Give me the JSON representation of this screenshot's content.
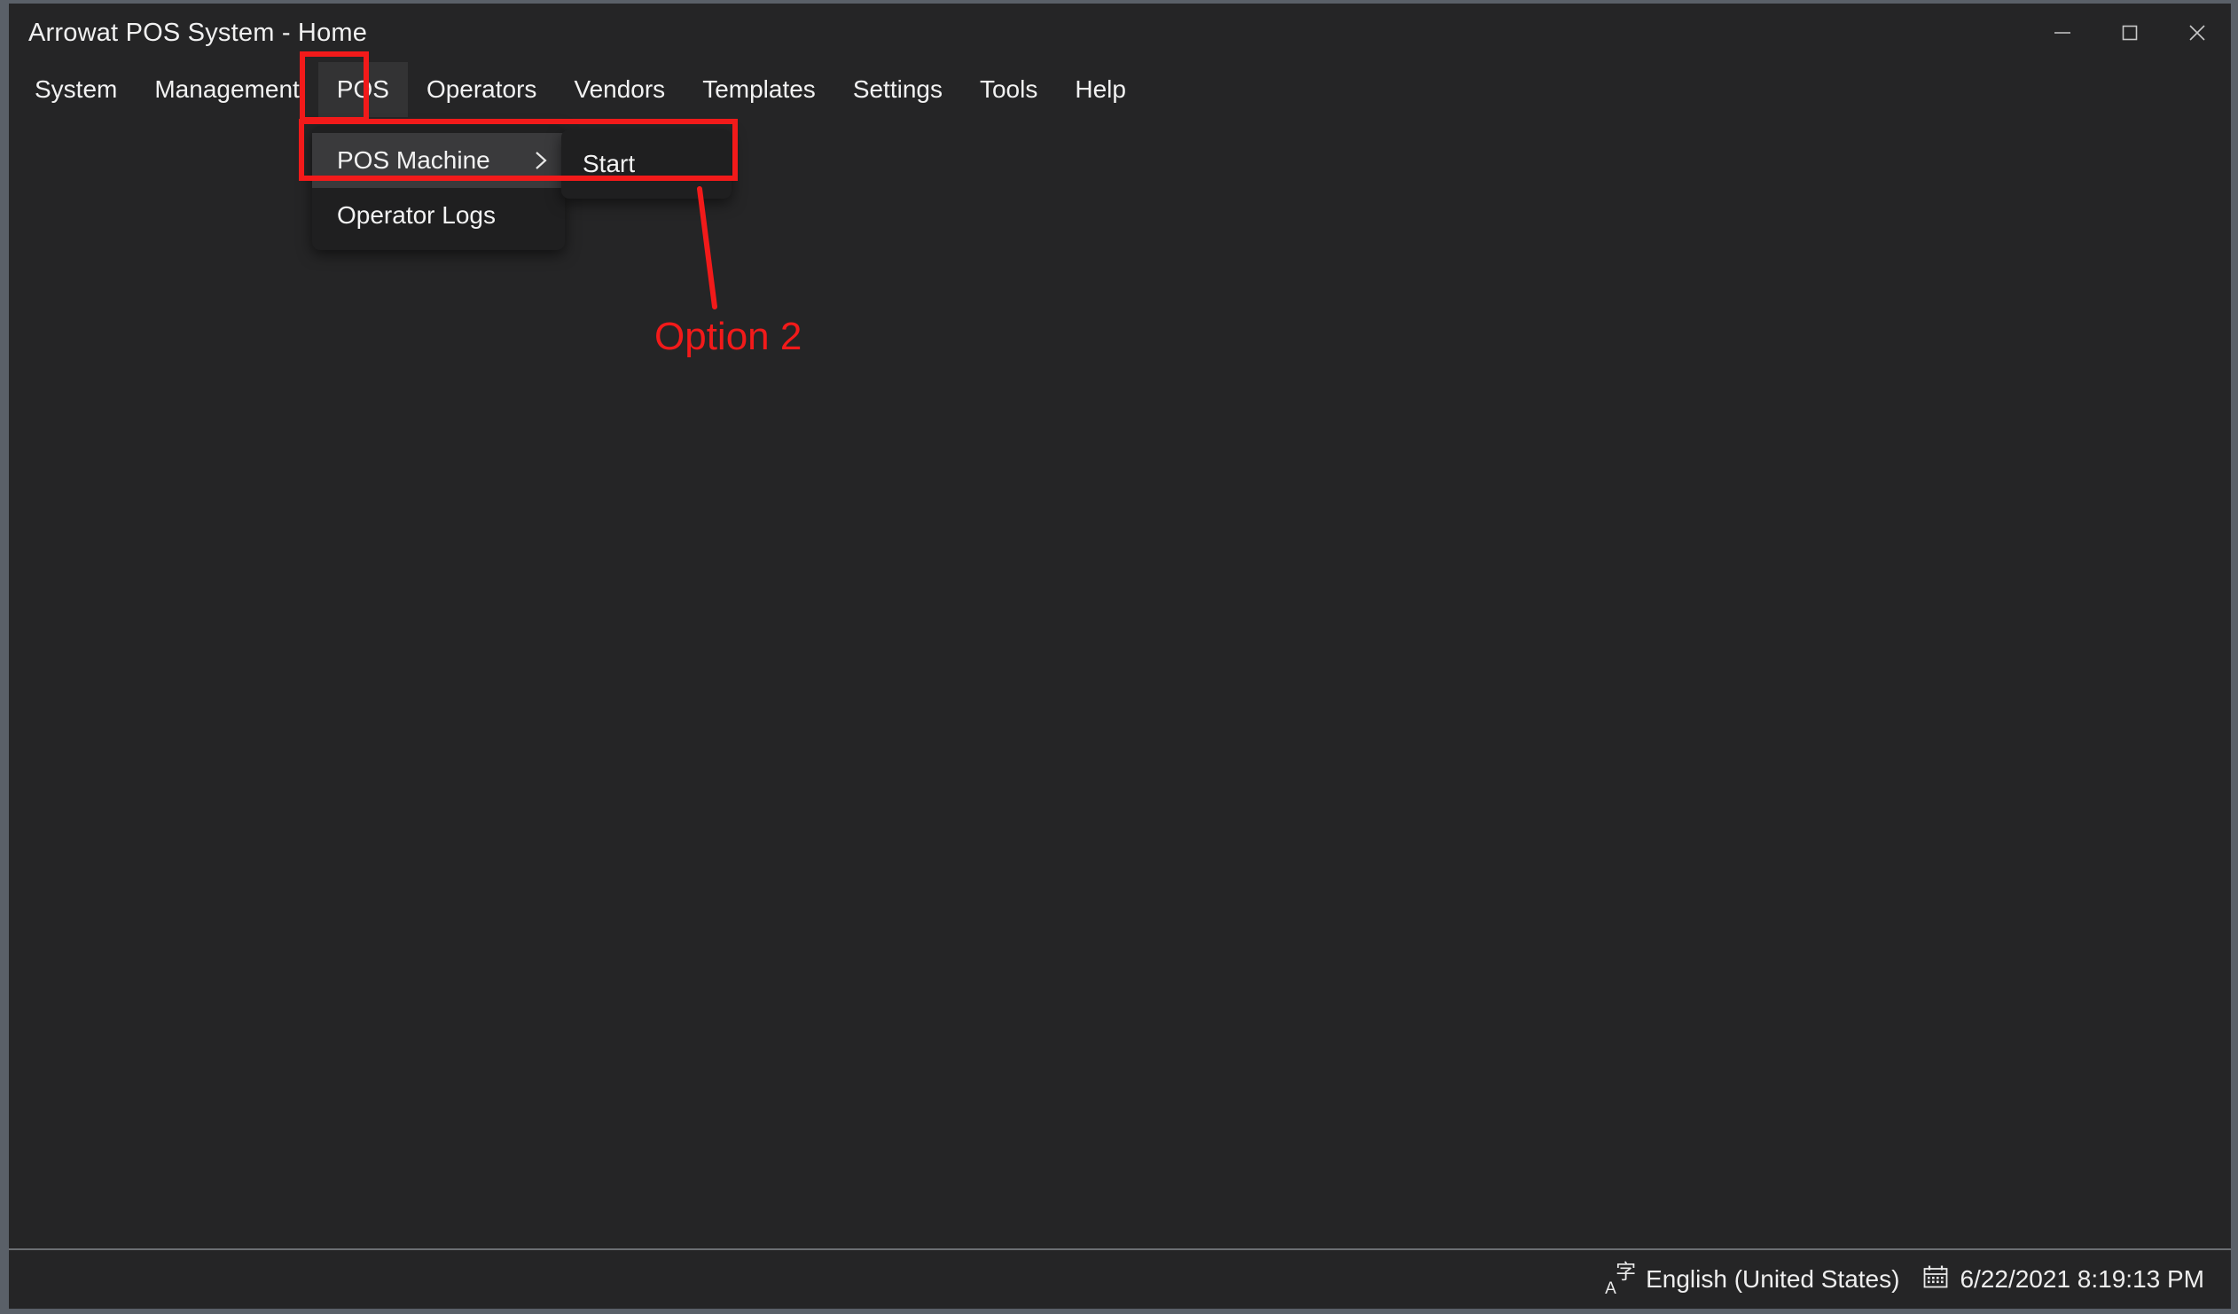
{
  "window": {
    "title": "Arrowat POS System - Home",
    "controls": [
      {
        "name": "minimize",
        "label": "—"
      },
      {
        "name": "maximize",
        "label": "□"
      },
      {
        "name": "close",
        "label": "✕"
      }
    ]
  },
  "menubar": {
    "items": [
      {
        "label": "System",
        "active": false
      },
      {
        "label": "Management",
        "active": false
      },
      {
        "label": "POS",
        "active": true
      },
      {
        "label": "Operators",
        "active": false
      },
      {
        "label": "Vendors",
        "active": false
      },
      {
        "label": "Templates",
        "active": false
      },
      {
        "label": "Settings",
        "active": false
      },
      {
        "label": "Tools",
        "active": false
      },
      {
        "label": "Help",
        "active": false
      }
    ]
  },
  "dropdown": {
    "items": [
      {
        "label": "POS Machine",
        "highlighted": true,
        "has_submenu": true
      },
      {
        "label": "Operator Logs",
        "highlighted": false,
        "has_submenu": false
      }
    ]
  },
  "submenu": {
    "items": [
      {
        "label": "Start"
      }
    ]
  },
  "annotation": {
    "label": "Option 2",
    "color": "#f21a1a"
  },
  "statusbar": {
    "language": "English (United States)",
    "language_icon": "language-input-icon",
    "datetime": "6/22/2021 8:19:13 PM",
    "calendar_icon": "calendar-icon"
  },
  "colors": {
    "window_bg": "#252526",
    "menu_active_bg": "#333334",
    "dropdown_bg": "#1f1f20",
    "dropdown_highlight_bg": "#3a3a3c",
    "annotation_red": "#f21a1a",
    "text": "#f2f2f2"
  }
}
